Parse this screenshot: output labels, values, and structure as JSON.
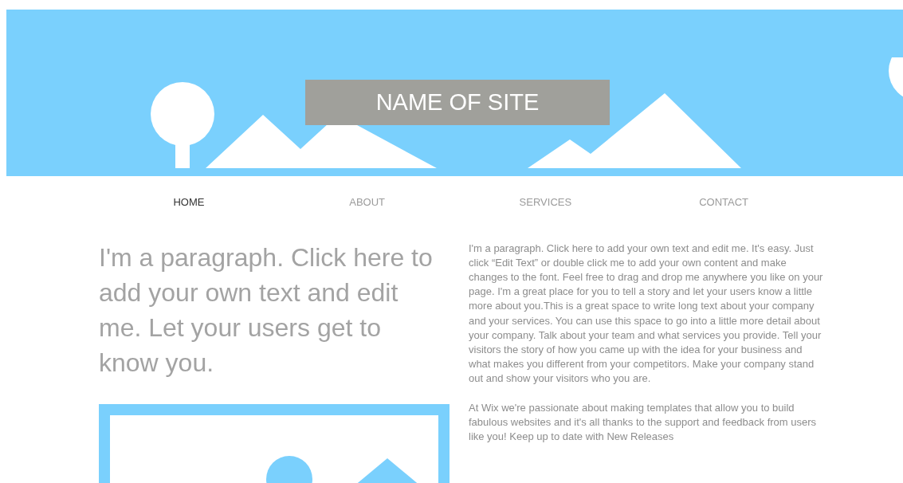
{
  "header": {
    "site_title": "NAME OF SITE"
  },
  "nav": [
    {
      "label": "HOME",
      "selected": true
    },
    {
      "label": "ABOUT",
      "selected": false
    },
    {
      "label": "SERVICES",
      "selected": false
    },
    {
      "label": "CONTACT",
      "selected": false
    }
  ],
  "heading": "I'm a paragraph. Click here to add your own text and edit me. Let your users get to know you.",
  "paragraphs": [
    "I'm a paragraph. Click here to add your own text and edit me. It's easy. Just click “Edit Text” or double click me to add your own content and make changes to the font. Feel free to drag and drop me anywhere you like on your page. I'm a great place for you to tell a story and let your users know a little more about you.This is a great space to write long text about your company and your services. You can use this space to go into a little more detail about your company. Talk about your team and what services you provide. Tell your visitors the story of how you came up with the idea for your business and what makes you different from your competitors. Make your company stand out and show your visitors who you are.",
    "At Wix we're passionate about making templates that allow you to build fabulous websites and it's all thanks to the support and feedback from users like you! Keep up to date with New Releases"
  ]
}
